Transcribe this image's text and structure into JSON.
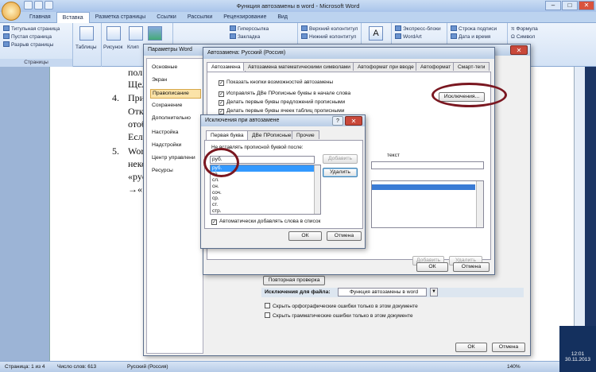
{
  "window": {
    "title": "Функция автозамены в word - Microsoft Word"
  },
  "ribbon_tabs": [
    "Главная",
    "Вставка",
    "Разметка страницы",
    "Ссылки",
    "Рассылки",
    "Рецензирование",
    "Вид"
  ],
  "ribbon": {
    "pages_group": {
      "items": [
        "Титульная страница",
        "Пустая страница",
        "Разрыв страницы"
      ],
      "label": "Страницы"
    },
    "table_label": "Таблицы",
    "picture_label": "Рисунок",
    "clip_label": "Клип",
    "links": [
      "Гиперссылка",
      "Закладка"
    ],
    "header_items": [
      "Верхний колонтитул",
      "Нижний колонтитул"
    ],
    "text_items": [
      "Экспресс-блоки",
      "WordArt"
    ],
    "sig_items": [
      "Строка подписи",
      "Дата и время"
    ],
    "formula_items": [
      "Формула",
      "Символ"
    ]
  },
  "document": {
    "lines": [
      "пол",
      "Щел",
      "При",
      "Отк",
      "отоб",
      "Если",
      "Wor",
      "неко",
      "«рус",
      "→«"
    ],
    "numbers": [
      "4.",
      "5."
    ]
  },
  "word_options": {
    "title": "Параметры Word",
    "nav": [
      "Основные",
      "Экран",
      "Правописание",
      "Сохранение",
      "Дополнительно",
      "Настройка",
      "Надстройки",
      "Центр управлени",
      "Ресурсы"
    ],
    "selected_nav": "Правописание",
    "file_exceptions_label": "Исключения для файла:",
    "file_name": "Функция автозамены в word",
    "check1": "Скрыть орфографические ошибки только в этом документе",
    "check2": "Скрыть грамматические ошибки только в этом документе",
    "recheck_button": "Повторная проверка",
    "ok": "ОК",
    "cancel": "Отмена"
  },
  "autocorrect": {
    "title": "Автозамена: Русский (Россия)",
    "tabs": [
      "Автозамена",
      "Автозамена математическими символами",
      "Автоформат при вводе",
      "Автоформат",
      "Смарт-теги"
    ],
    "checks": [
      "Показать кнопки возможностей автозамены",
      "Исправлять ДВе ПРописные буквы в начале слова",
      "Делать первые буквы предложений прописными",
      "Делать первые буквы ячеек таблиц прописными"
    ],
    "exceptions_button": "Исключения...",
    "text_label": "текст",
    "add": "Добавить",
    "delete": "Удалить",
    "ok": "ОК",
    "cancel": "Отмена"
  },
  "exceptions": {
    "title": "Исключения при автозамене",
    "tabs": [
      "Первая буква",
      "ДВе ПРописные",
      "Прочие"
    ],
    "field_label": "Не вставлять прописной буквой после:",
    "input_value": "руб.",
    "list": [
      "руб.",
      "св.",
      "сл.",
      "сн.",
      "соч.",
      "ср.",
      "ст.",
      "стр."
    ],
    "selected": "руб.",
    "add": "Добавить",
    "delete": "Удалить",
    "auto_add": "Автоматически добавлять слова в список",
    "ok": "ОК",
    "cancel": "Отмена"
  },
  "status": {
    "page": "Страница: 1 из 4",
    "words": "Число слов: 613",
    "lang": "Русский (Россия)",
    "zoom": "140%"
  },
  "clock": {
    "time": "12:01",
    "date": "30.11.2013"
  }
}
